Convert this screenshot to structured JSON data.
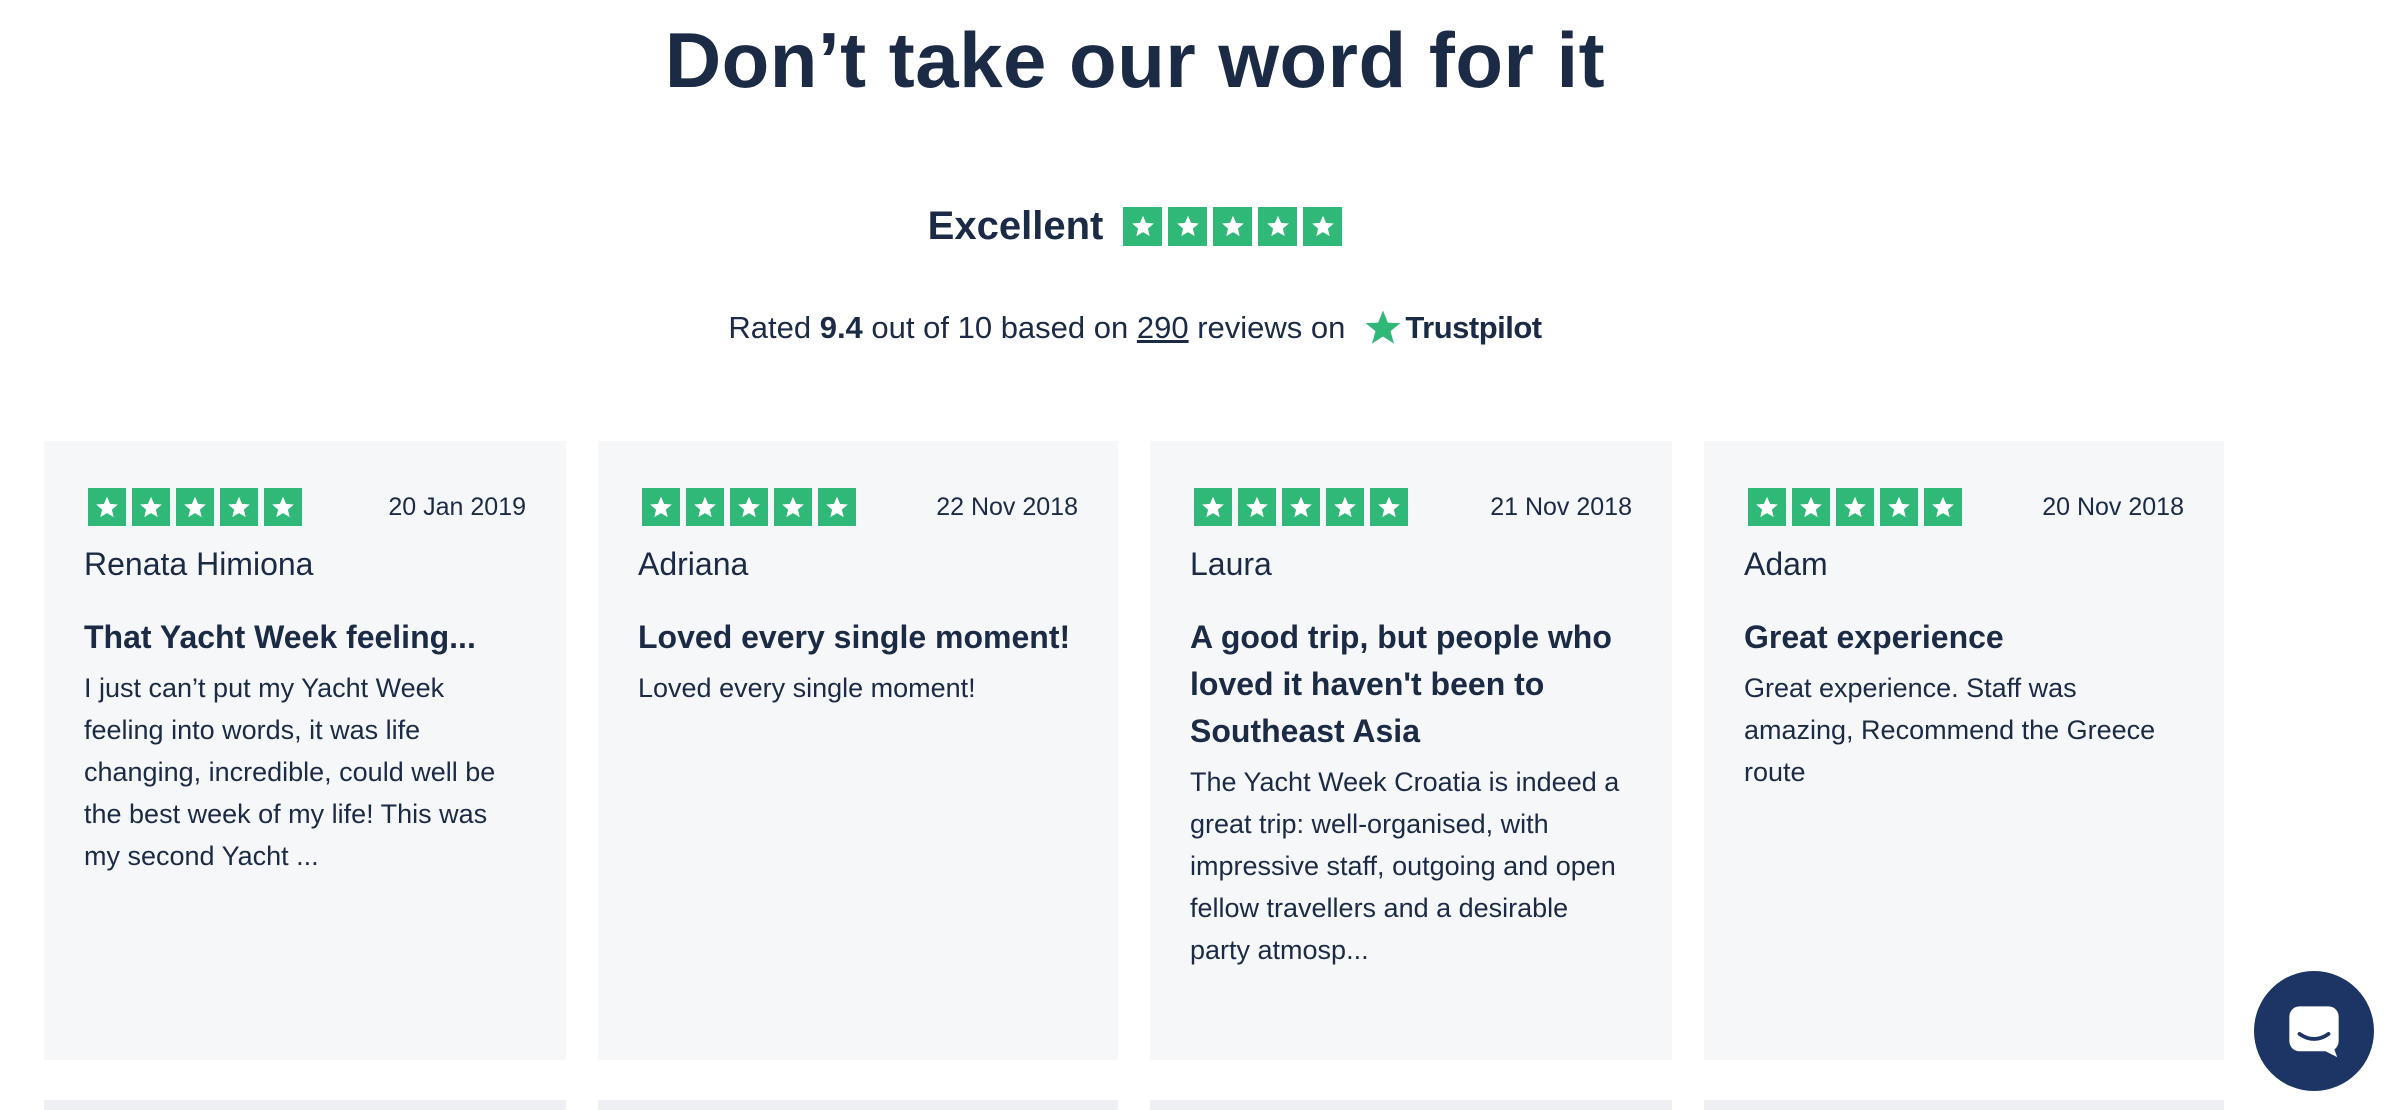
{
  "headline": "Don’t take our word for it",
  "summary": {
    "excellent_label": "Excellent",
    "rating_stars": 5,
    "rated_prefix": "Rated ",
    "score": "9.4",
    "out_of": " out of 10 based on ",
    "review_count": "290",
    "reviews_on": " reviews on",
    "platform_name": "Trustpilot"
  },
  "colors": {
    "star_green": "#2fb878",
    "text_navy": "#1b2a45",
    "card_bg": "#f6f7f9",
    "chat_button": "#1d3564"
  },
  "reviews": [
    {
      "stars": 5,
      "date": "20 Jan 2019",
      "author": "Renata Himiona",
      "title": "That Yacht Week feeling...",
      "body": "I just can’t put my Yacht Week feeling into words, it was life changing, incredible, could well be the best week of my life! This was my second Yacht ..."
    },
    {
      "stars": 5,
      "date": "22 Nov 2018",
      "author": "Adriana",
      "title": "Loved every single moment!",
      "body": "Loved every single moment!"
    },
    {
      "stars": 5,
      "date": "21 Nov 2018",
      "author": "Laura",
      "title": "A good trip, but people who loved it haven't been to Southeast Asia",
      "body": "The Yacht Week Croatia is indeed a great trip: well-organised, with impressive staff, outgoing and open fellow travellers and a desirable party atmosp..."
    },
    {
      "stars": 5,
      "date": "20 Nov 2018",
      "author": "Adam",
      "title": "Great experience",
      "body": "Great experience. Staff was amazing, Recommend the Greece route"
    }
  ],
  "chat": {
    "icon": "chat-bubble-icon"
  }
}
